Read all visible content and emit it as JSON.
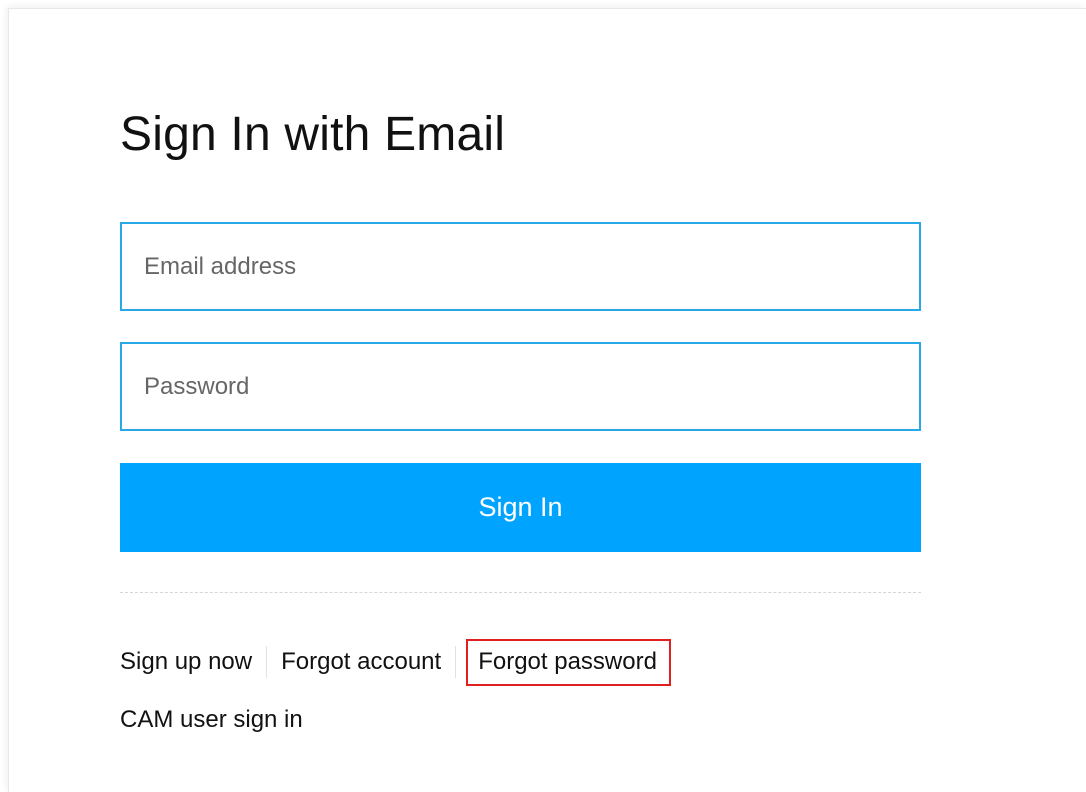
{
  "form": {
    "title": "Sign In with Email",
    "email_placeholder": "Email address",
    "password_placeholder": "Password",
    "signin_label": "Sign In"
  },
  "links": {
    "sign_up": "Sign up now",
    "forgot_account": "Forgot account",
    "forgot_password": "Forgot password",
    "cam_user": "CAM user sign in"
  },
  "colors": {
    "accent": "#00a4ff",
    "input_border": "#29a8e8",
    "highlight_box": "#e02020"
  }
}
